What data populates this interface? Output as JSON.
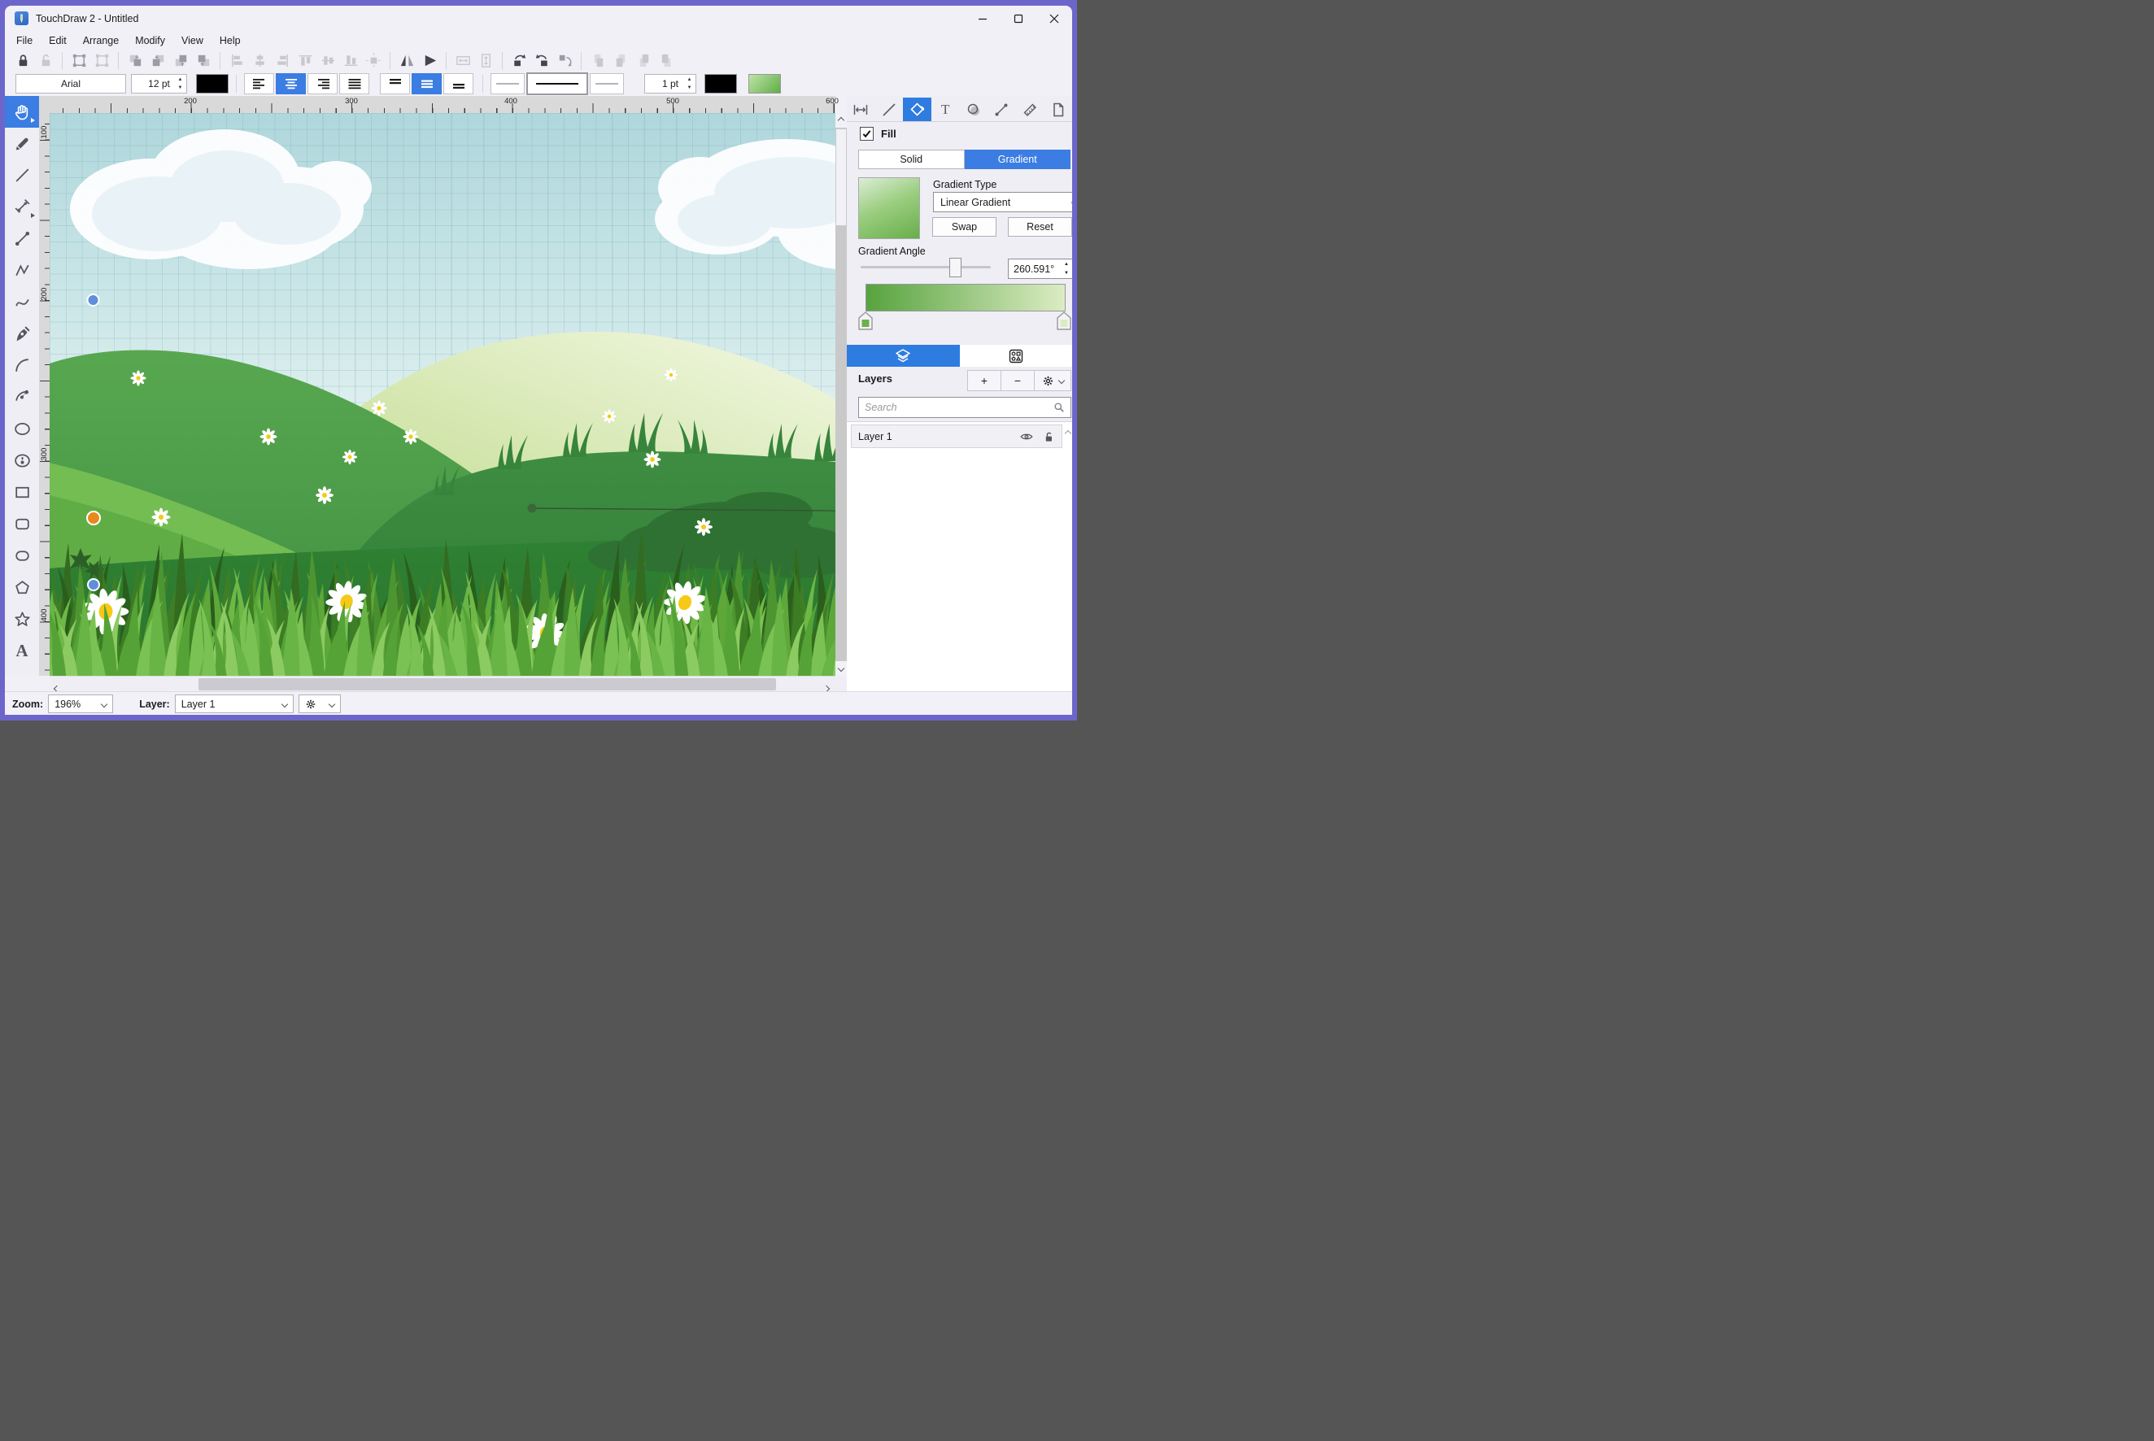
{
  "window": {
    "title": "TouchDraw 2 - Untitled"
  },
  "menu": {
    "items": [
      "File",
      "Edit",
      "Arrange",
      "Modify",
      "View",
      "Help"
    ]
  },
  "toolbar_format": {
    "font_family": "Arial",
    "font_size": "12 pt",
    "stroke_width": "1 pt",
    "text_color": "#000000",
    "stroke_color": "#000000",
    "fill_swatch_gradient": [
      "#bfe3a8",
      "#5fae45"
    ]
  },
  "toolbar_icons": [
    "lock",
    "unlock",
    "insert-frame",
    "insert-frame-alt",
    "bring-to-front",
    "bring-forward",
    "send-backward",
    "send-to-back",
    "align-left",
    "align-center-h",
    "align-right",
    "align-top",
    "align-middle-v",
    "align-bottom",
    "align-canvas-center",
    "flip-horizontal",
    "flip-vertical",
    "make-same-width",
    "make-same-height",
    "rotate-left",
    "rotate-right",
    "rotate-shape",
    "nudge-a",
    "nudge-b",
    "nudge-c",
    "nudge-d"
  ],
  "palette_tools": [
    "pan",
    "pencil",
    "line",
    "dimension",
    "connector",
    "polyline",
    "curve",
    "pen",
    "arc",
    "arc-3point",
    "ellipse",
    "ellipse-center",
    "rectangle",
    "rounded-rectangle",
    "stadium",
    "polygon",
    "star",
    "text"
  ],
  "rulers": {
    "horizontal": [
      "200",
      "300",
      "400",
      "500",
      "600"
    ],
    "vertical": [
      "100",
      "200",
      "300",
      "400"
    ]
  },
  "panel_tabs": [
    "metrics",
    "stroke",
    "fill",
    "text",
    "shape",
    "connection",
    "measure",
    "page"
  ],
  "fill_panel": {
    "fill_label": "Fill",
    "fill_checked": true,
    "solid_label": "Solid",
    "gradient_label": "Gradient",
    "selected_mode": "Gradient",
    "gradient_type_label": "Gradient Type",
    "gradient_type_value": "Linear Gradient",
    "swap_label": "Swap",
    "reset_label": "Reset",
    "gradient_angle_label": "Gradient Angle",
    "gradient_angle_value": "260.591°",
    "gradient_start_color": "#57a33e",
    "gradient_end_color": "#dcecc4"
  },
  "layers_panel": {
    "title": "Layers",
    "add_label": "+",
    "remove_label": "−",
    "search_placeholder": "Search",
    "layers": [
      {
        "name": "Layer 1",
        "visible": true,
        "locked": false
      }
    ]
  },
  "status_bar": {
    "zoom_label": "Zoom:",
    "zoom_value": "196%",
    "layer_label": "Layer:",
    "layer_value": "Layer 1"
  },
  "colors": {
    "accent_blue": "#3b7de2",
    "window_border": "#6c66cb",
    "sky_top": "#afd7dc",
    "selection_handle_blue": "#5f8edb",
    "selection_handle_orange": "#e8891d"
  }
}
